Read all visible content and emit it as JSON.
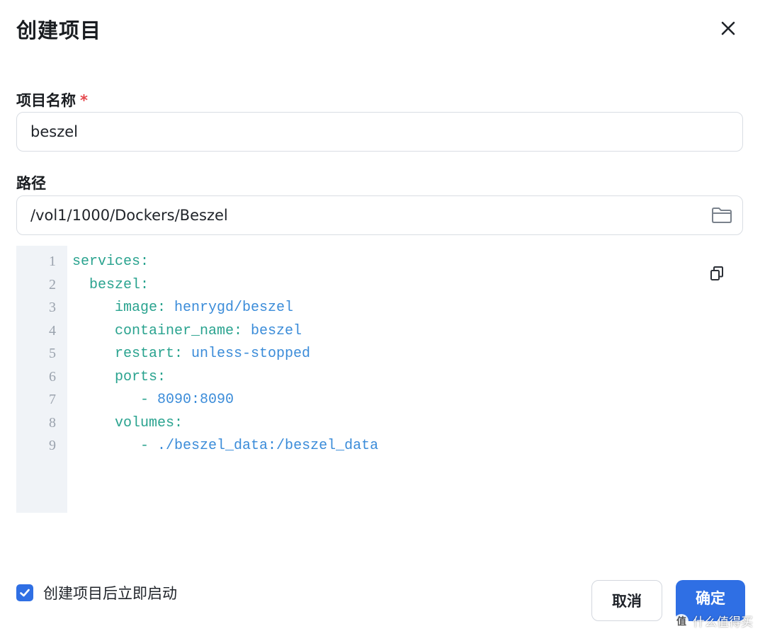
{
  "dialog": {
    "title": "创建项目",
    "close_icon": "close-icon"
  },
  "fields": {
    "name": {
      "label": "项目名称",
      "required_mark": "*",
      "value": "beszel"
    },
    "path": {
      "label": "路径",
      "value": "/vol1/1000/Dockers/Beszel",
      "icon": "folder-icon"
    }
  },
  "editor": {
    "copy_icon": "copy-icon",
    "lines": [
      {
        "no": "1",
        "indent": "",
        "key": "services:",
        "value": ""
      },
      {
        "no": "2",
        "indent": "  ",
        "key": "beszel:",
        "value": ""
      },
      {
        "no": "3",
        "indent": "     ",
        "key": "image:",
        "value": " henrygd/beszel"
      },
      {
        "no": "4",
        "indent": "     ",
        "key": "container_name:",
        "value": " beszel"
      },
      {
        "no": "5",
        "indent": "     ",
        "key": "restart:",
        "value": " unless-stopped"
      },
      {
        "no": "6",
        "indent": "     ",
        "key": "ports:",
        "value": ""
      },
      {
        "no": "7",
        "indent": "        ",
        "key": "- ",
        "value": "8090:8090"
      },
      {
        "no": "8",
        "indent": "     ",
        "key": "volumes:",
        "value": ""
      },
      {
        "no": "9",
        "indent": "        ",
        "key": "- ",
        "value": "./beszel_data:/beszel_data"
      }
    ],
    "colors": {
      "key": "#2aa38f",
      "value": "#3b8cd9",
      "line_number": "#9aa2ad",
      "gutter": "#f0f3f7"
    }
  },
  "footer": {
    "autostart_label": "创建项目后立即启动",
    "autostart_checked": true,
    "cancel_label": "取消",
    "confirm_label": "确定"
  },
  "watermark": {
    "badge": "值",
    "text": "什么值得买"
  },
  "colors": {
    "accent": "#2f6fe4",
    "required": "#e5484d"
  }
}
